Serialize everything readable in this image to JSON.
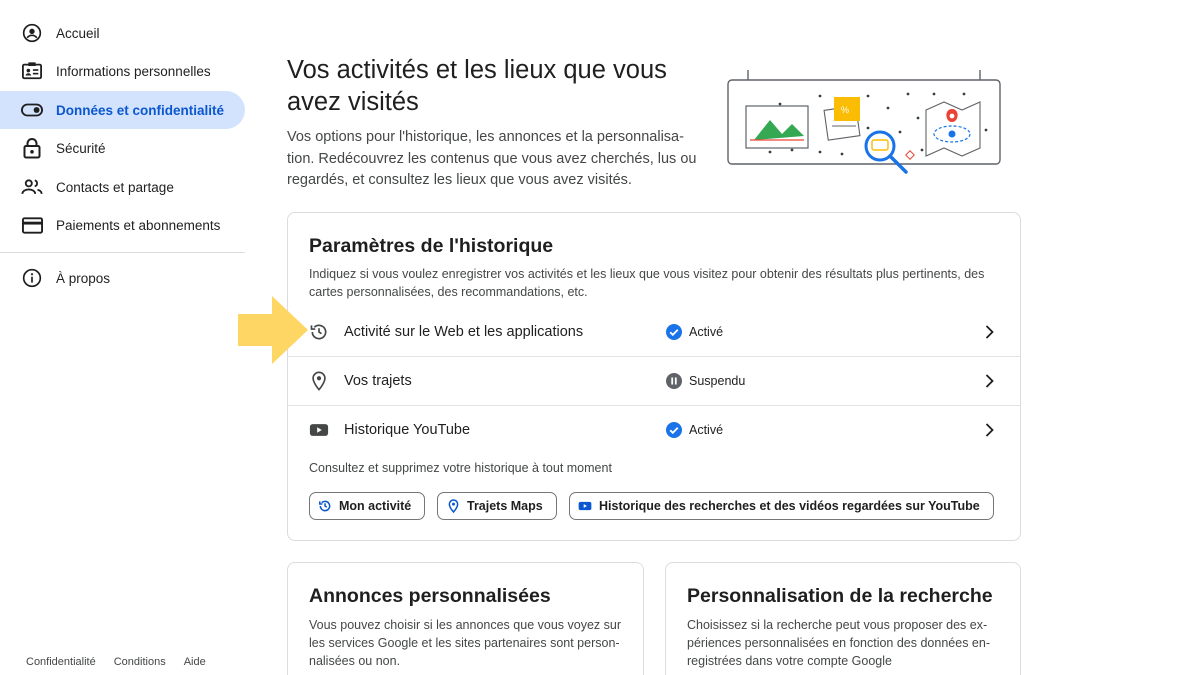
{
  "sidebar": {
    "items": [
      {
        "label": "Accueil",
        "icon": "account-circle-icon"
      },
      {
        "label": "Informations personnelles",
        "icon": "id-card-icon"
      },
      {
        "label": "Données et confidentialité",
        "icon": "toggle-icon"
      },
      {
        "label": "Sécurité",
        "icon": "lock-icon"
      },
      {
        "label": "Contacts et partage",
        "icon": "people-icon"
      },
      {
        "label": "Paiements et abonnements",
        "icon": "credit-card-icon"
      },
      {
        "label": "À propos",
        "icon": "info-icon"
      }
    ],
    "active_index": 2,
    "footer": [
      "Confidentialité",
      "Conditions",
      "Aide"
    ]
  },
  "header": {
    "title": "Vos activités et les lieux que vous avez visités",
    "description": "Vos options pour l'historique, les annonces et la personnalisa-tion. Redécouvrez les contenus que vous avez cherchés, lus ou regardés, et consultez les lieux que vous avez visités."
  },
  "history": {
    "title": "Paramètres de l'historique",
    "description": "Indiquez si vous voulez enregistrer vos activités et les lieux que vous visitez pour obtenir des résultats plus pertinents, des cartes personnalisées, des recommandations, etc.",
    "rows": [
      {
        "label": "Activité sur le Web et les applications",
        "status": "Activé",
        "icon": "history-icon",
        "status_icon": "check-circle-icon"
      },
      {
        "label": "Vos trajets",
        "status": "Suspendu",
        "icon": "location-pin-icon",
        "status_icon": "pause-circle-icon"
      },
      {
        "label": "Historique YouTube",
        "status": "Activé",
        "icon": "youtube-icon",
        "status_icon": "check-circle-icon"
      }
    ],
    "consult_text": "Consultez et supprimez votre historique à tout moment",
    "chips": [
      {
        "label": "Mon activité",
        "icon": "history-icon"
      },
      {
        "label": "Trajets Maps",
        "icon": "location-pin-icon"
      },
      {
        "label": "Historique des recherches et des vidéos regardées sur YouTube",
        "icon": "youtube-icon"
      }
    ]
  },
  "ads": {
    "title": "Annonces personnalisées",
    "description": "Vous pouvez choisir si les annonces que vous voyez sur les services Google et les sites partenaires sont person-nalisées ou non."
  },
  "search_personalization": {
    "title": "Personnalisation de la recherche",
    "description": "Choisissez si la recherche peut vous proposer des ex-périences personnalisées en fonction des données en-registrées dans votre compte Google"
  },
  "colors": {
    "accent": "#0b57d0",
    "active_nav_bg": "#d3e3fd",
    "status_on": "#1a73e8",
    "status_paused": "#5f6368",
    "highlight_arrow": "#fdd663"
  }
}
